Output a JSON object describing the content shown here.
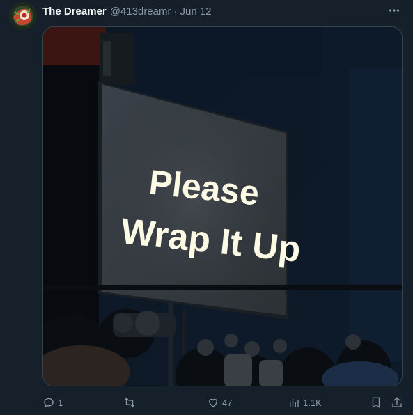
{
  "tweet": {
    "author": {
      "display_name": "The Dreamer",
      "handle": "@413dreamr",
      "avatar_icon": "avatar-image"
    },
    "separator": "·",
    "date": "Jun 12",
    "more_icon": "more-dots-icon",
    "media": {
      "sign_text_line1": "Please",
      "sign_text_line2": "Wrap It Up"
    },
    "actions": {
      "reply_count": "1",
      "retweet_count": "",
      "like_count": "47",
      "views_count": "1.1K"
    }
  },
  "colors": {
    "background": "#15202b",
    "primary_text": "#f7f9f9",
    "secondary_text": "#8b98a5",
    "border": "#38444d"
  }
}
